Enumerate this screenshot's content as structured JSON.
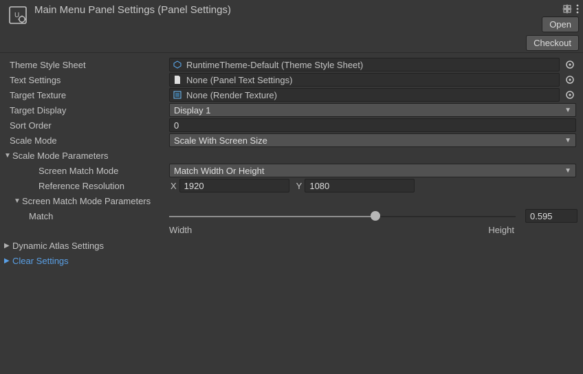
{
  "header": {
    "title": "Main Menu Panel Settings (Panel Settings)",
    "open_btn": "Open",
    "checkout_btn": "Checkout"
  },
  "fields": {
    "theme_label": "Theme Style Sheet",
    "theme_value": "RuntimeTheme-Default (Theme Style Sheet)",
    "text_label": "Text Settings",
    "text_value": "None (Panel Text Settings)",
    "texture_label": "Target Texture",
    "texture_value": "None (Render Texture)",
    "display_label": "Target Display",
    "display_value": "Display 1",
    "sort_label": "Sort Order",
    "sort_value": "0",
    "scalemode_label": "Scale Mode",
    "scalemode_value": "Scale With Screen Size"
  },
  "scale_params": {
    "section_label": "Scale Mode Parameters",
    "match_mode_label": "Screen Match Mode",
    "match_mode_value": "Match Width Or Height",
    "ref_res_label": "Reference Resolution",
    "ref_x_label": "X",
    "ref_x_value": "1920",
    "ref_y_label": "Y",
    "ref_y_value": "1080",
    "match_params_label": "Screen Match Mode Parameters",
    "match_label": "Match",
    "match_value": "0.595",
    "match_left": "Width",
    "match_right": "Height"
  },
  "sections": {
    "atlas": "Dynamic Atlas Settings",
    "clear": "Clear Settings"
  }
}
